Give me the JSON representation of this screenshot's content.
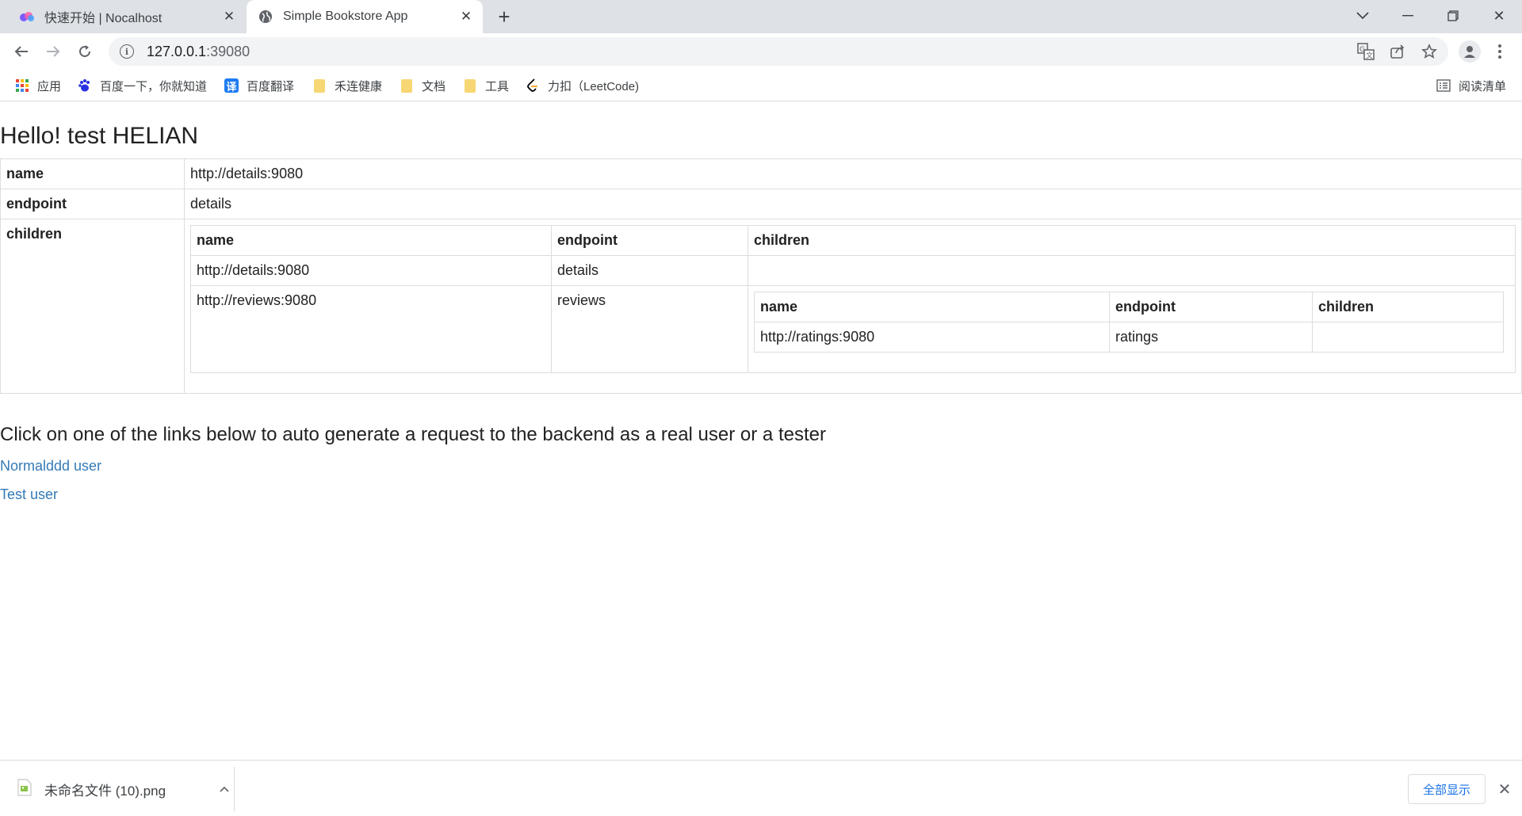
{
  "tabs": [
    {
      "title": "快速开始 | Nocalhost",
      "icon": "nocalhost-icon"
    },
    {
      "title": "Simple Bookstore App",
      "icon": "globe-icon"
    }
  ],
  "address_bar": {
    "host": "127.0.0.1",
    "port": ":39080"
  },
  "bookmarks": [
    {
      "label": "应用",
      "icon": "apps-grid-icon"
    },
    {
      "label": "百度一下，你就知道",
      "icon": "baidu-paw-icon"
    },
    {
      "label": "百度翻译",
      "icon": "translate-icon",
      "icon_glyph": "译"
    },
    {
      "label": "禾连健康",
      "icon": "folder-icon"
    },
    {
      "label": "文档",
      "icon": "folder-icon"
    },
    {
      "label": "工具",
      "icon": "folder-icon"
    },
    {
      "label": "力扣（LeetCode)",
      "icon": "leetcode-icon"
    }
  ],
  "reading_list": {
    "label": "阅读清单",
    "icon": "reading-list-icon"
  },
  "page": {
    "heading": "Hello! test HELIAN",
    "outer_table": {
      "rows": [
        {
          "key": "name",
          "value": "http://details:9080"
        },
        {
          "key": "endpoint",
          "value": "details"
        },
        {
          "key": "children"
        }
      ]
    },
    "children_table": {
      "headers": [
        "name",
        "endpoint",
        "children"
      ],
      "rows": [
        {
          "name": "http://details:9080",
          "endpoint": "details"
        },
        {
          "name": "http://reviews:9080",
          "endpoint": "reviews"
        }
      ]
    },
    "grandchildren_table": {
      "headers": [
        "name",
        "endpoint",
        "children"
      ],
      "rows": [
        {
          "name": "http://ratings:9080",
          "endpoint": "ratings"
        }
      ]
    },
    "lead_text": "Click on one of the links below to auto generate a request to the backend as a real user or a tester",
    "links": [
      "Normalddd user",
      "Test user"
    ]
  },
  "download_bar": {
    "file_name": "未命名文件 (10).png",
    "show_all": "全部显示"
  },
  "colors": {
    "tab_strip": "#dee1e6",
    "link": "#337ab7",
    "show_all": "#1a73e8",
    "table_border": "#dddddd"
  }
}
